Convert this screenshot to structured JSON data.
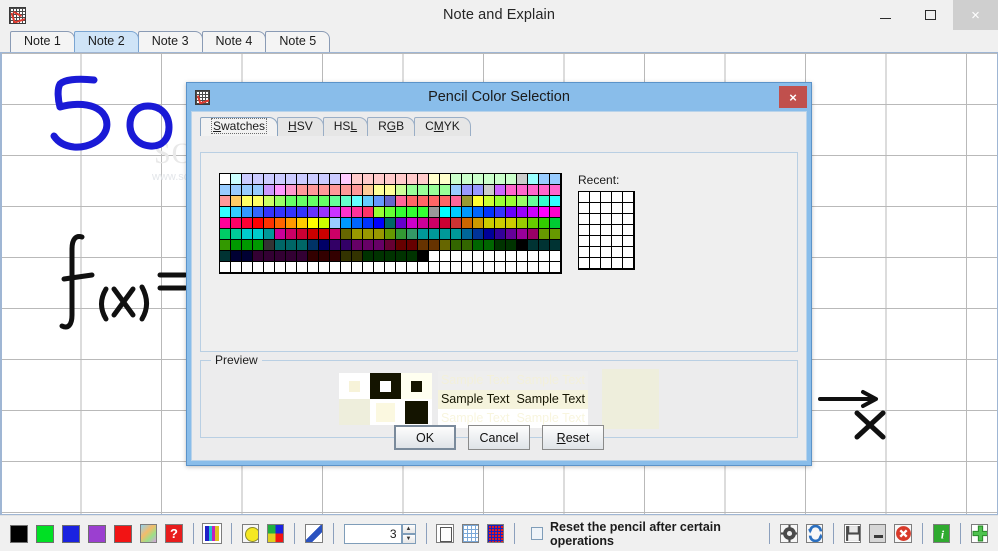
{
  "window": {
    "title": "Note and Explain",
    "icon": "note-grid-icon",
    "controls": {
      "minimize": "–",
      "maximize": "☐",
      "close": "×"
    }
  },
  "tabs": [
    {
      "label": "Note 1",
      "active": false
    },
    {
      "label": "Note 2",
      "active": true
    },
    {
      "label": "Note 3",
      "active": false
    },
    {
      "label": "Note 4",
      "active": false
    },
    {
      "label": "Note 5",
      "active": false
    }
  ],
  "canvas": {
    "watermark": "SOFTPEDIA",
    "watermark_small": "www.softpedia.com",
    "ink": [
      {
        "name": "digit-five-blue",
        "color": "#1a1ad6"
      },
      {
        "name": "digit-zero-blue",
        "color": "#1a1ad6"
      },
      {
        "name": "fx-equals-black",
        "color": "#101010"
      },
      {
        "name": "arrow-right-black",
        "color": "#101010"
      },
      {
        "name": "letter-x-black",
        "color": "#101010"
      },
      {
        "name": "blue-stroke-top",
        "color": "#1a1ad6"
      },
      {
        "name": "blue-dot-top",
        "color": "#1a1ad6"
      }
    ]
  },
  "dialog": {
    "title": "Pencil Color Selection",
    "close_label": "×",
    "tabs": [
      {
        "label": "Swatches",
        "mnemonic": "S",
        "active": true
      },
      {
        "label": "HSV",
        "mnemonic": "H",
        "active": false
      },
      {
        "label": "HSL",
        "mnemonic": "L",
        "active": false
      },
      {
        "label": "RGB",
        "mnemonic": "G",
        "active": false
      },
      {
        "label": "CMYK",
        "mnemonic": "M",
        "active": false
      }
    ],
    "recent_label": "Recent:",
    "recent_color": "#ffffff",
    "recent_cols": 5,
    "recent_rows": 7,
    "preview_legend": "Preview",
    "preview_sample_text": "Sample Text  Sample Text",
    "preview_colors": {
      "selected": "#fffff0",
      "dark": "#141400",
      "band": "#f5f3dc",
      "white": "#ffffff",
      "big": "#eeeedc"
    },
    "buttons": [
      {
        "label": "OK",
        "mnemonic": "",
        "default": true
      },
      {
        "label": "Cancel",
        "mnemonic": "",
        "default": false
      },
      {
        "label": "Reset",
        "mnemonic": "R",
        "default": false
      }
    ]
  },
  "toolbar": {
    "colors": [
      {
        "name": "color-black",
        "value": "#000000"
      },
      {
        "name": "color-green",
        "value": "#00e024"
      },
      {
        "name": "color-blue",
        "value": "#1a22e0"
      },
      {
        "name": "color-purple",
        "value": "#9b3fd0"
      },
      {
        "name": "color-red",
        "value": "#f21414"
      }
    ],
    "icons_left": [
      {
        "name": "custom-gradient-color-icon"
      },
      {
        "name": "help-color-icon"
      }
    ],
    "icons_palette": [
      {
        "name": "color-palette-icon"
      }
    ],
    "icons_fill": [
      {
        "name": "yellow-circle-icon"
      },
      {
        "name": "color-mix-icon"
      }
    ],
    "icons_eraser": [
      {
        "name": "eraser-icon"
      }
    ],
    "spinner": {
      "value": "3",
      "up": "▲",
      "down": "▼"
    },
    "icons_page": [
      {
        "name": "new-page-icon"
      },
      {
        "name": "grid-toggle-icon"
      },
      {
        "name": "grid-red-icon"
      }
    ],
    "checkbox": {
      "label": "Reset the pencil after certain operations",
      "checked": false
    },
    "icons_right_a": [
      {
        "name": "settings-gear-icon"
      },
      {
        "name": "refresh-icon"
      }
    ],
    "icons_right_b": [
      {
        "name": "save-icon"
      },
      {
        "name": "minimize-icon"
      },
      {
        "name": "close-red-icon"
      }
    ],
    "icons_right_c": [
      {
        "name": "info-icon"
      }
    ],
    "icons_right_d": [
      {
        "name": "add-icon"
      }
    ]
  }
}
